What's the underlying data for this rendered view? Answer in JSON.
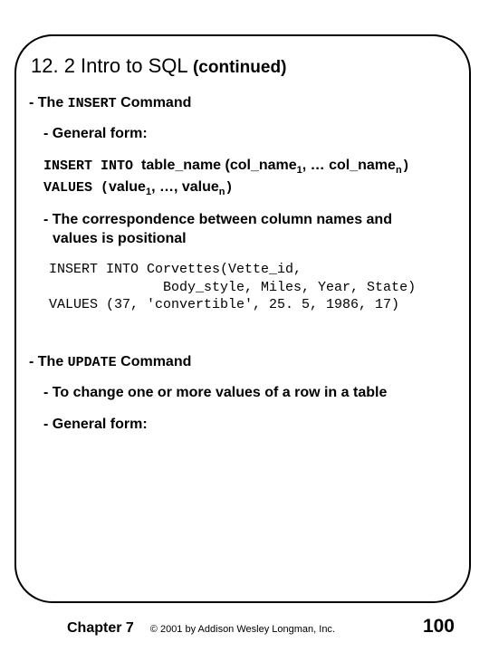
{
  "title": {
    "main": "12. 2 Intro to SQL ",
    "cont": "(continued)"
  },
  "section_insert": {
    "heading_prefix": "- The ",
    "heading_kw": "INSERT",
    "heading_suffix": " Command",
    "general_form": "- General form:",
    "form_line1_a": "INSERT INTO ",
    "form_line1_b": "table_name (",
    "form_line1_c": "col_name",
    "form_line1_sub1": "1",
    "form_line1_d": ", … col_name",
    "form_line1_subn": "n",
    "form_line1_e": ")",
    "form_line2_a": "VALUES (",
    "form_line2_b": "value",
    "form_line2_sub1": "1",
    "form_line2_c": ", …, value",
    "form_line2_subn": "n",
    "form_line2_d": ")",
    "note_prefix": "- The correspondence between column names and",
    "note_cont": "values is positional",
    "code": "INSERT INTO Corvettes(Vette_id,\n              Body_style, Miles, Year, State)\nVALUES (37, 'convertible', 25. 5, 1986, 17)"
  },
  "section_update": {
    "heading_prefix": "- The ",
    "heading_kw": "UPDATE",
    "heading_suffix": " Command",
    "bullet1": "- To change one or more values of a row in a table",
    "bullet2": "- General form:"
  },
  "footer": {
    "chapter": "Chapter 7",
    "copyright": "© 2001 by Addison Wesley Longman, Inc.",
    "page": "100"
  }
}
